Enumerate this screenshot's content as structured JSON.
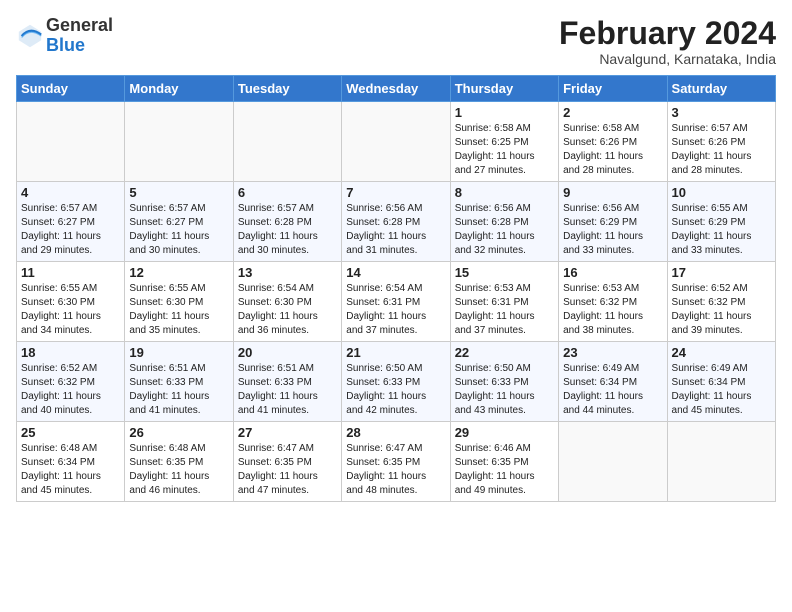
{
  "logo": {
    "general": "General",
    "blue": "Blue"
  },
  "title": "February 2024",
  "location": "Navalgund, Karnataka, India",
  "weekdays": [
    "Sunday",
    "Monday",
    "Tuesday",
    "Wednesday",
    "Thursday",
    "Friday",
    "Saturday"
  ],
  "weeks": [
    [
      {
        "day": "",
        "info": ""
      },
      {
        "day": "",
        "info": ""
      },
      {
        "day": "",
        "info": ""
      },
      {
        "day": "",
        "info": ""
      },
      {
        "day": "1",
        "info": "Sunrise: 6:58 AM\nSunset: 6:25 PM\nDaylight: 11 hours\nand 27 minutes."
      },
      {
        "day": "2",
        "info": "Sunrise: 6:58 AM\nSunset: 6:26 PM\nDaylight: 11 hours\nand 28 minutes."
      },
      {
        "day": "3",
        "info": "Sunrise: 6:57 AM\nSunset: 6:26 PM\nDaylight: 11 hours\nand 28 minutes."
      }
    ],
    [
      {
        "day": "4",
        "info": "Sunrise: 6:57 AM\nSunset: 6:27 PM\nDaylight: 11 hours\nand 29 minutes."
      },
      {
        "day": "5",
        "info": "Sunrise: 6:57 AM\nSunset: 6:27 PM\nDaylight: 11 hours\nand 30 minutes."
      },
      {
        "day": "6",
        "info": "Sunrise: 6:57 AM\nSunset: 6:28 PM\nDaylight: 11 hours\nand 30 minutes."
      },
      {
        "day": "7",
        "info": "Sunrise: 6:56 AM\nSunset: 6:28 PM\nDaylight: 11 hours\nand 31 minutes."
      },
      {
        "day": "8",
        "info": "Sunrise: 6:56 AM\nSunset: 6:28 PM\nDaylight: 11 hours\nand 32 minutes."
      },
      {
        "day": "9",
        "info": "Sunrise: 6:56 AM\nSunset: 6:29 PM\nDaylight: 11 hours\nand 33 minutes."
      },
      {
        "day": "10",
        "info": "Sunrise: 6:55 AM\nSunset: 6:29 PM\nDaylight: 11 hours\nand 33 minutes."
      }
    ],
    [
      {
        "day": "11",
        "info": "Sunrise: 6:55 AM\nSunset: 6:30 PM\nDaylight: 11 hours\nand 34 minutes."
      },
      {
        "day": "12",
        "info": "Sunrise: 6:55 AM\nSunset: 6:30 PM\nDaylight: 11 hours\nand 35 minutes."
      },
      {
        "day": "13",
        "info": "Sunrise: 6:54 AM\nSunset: 6:30 PM\nDaylight: 11 hours\nand 36 minutes."
      },
      {
        "day": "14",
        "info": "Sunrise: 6:54 AM\nSunset: 6:31 PM\nDaylight: 11 hours\nand 37 minutes."
      },
      {
        "day": "15",
        "info": "Sunrise: 6:53 AM\nSunset: 6:31 PM\nDaylight: 11 hours\nand 37 minutes."
      },
      {
        "day": "16",
        "info": "Sunrise: 6:53 AM\nSunset: 6:32 PM\nDaylight: 11 hours\nand 38 minutes."
      },
      {
        "day": "17",
        "info": "Sunrise: 6:52 AM\nSunset: 6:32 PM\nDaylight: 11 hours\nand 39 minutes."
      }
    ],
    [
      {
        "day": "18",
        "info": "Sunrise: 6:52 AM\nSunset: 6:32 PM\nDaylight: 11 hours\nand 40 minutes."
      },
      {
        "day": "19",
        "info": "Sunrise: 6:51 AM\nSunset: 6:33 PM\nDaylight: 11 hours\nand 41 minutes."
      },
      {
        "day": "20",
        "info": "Sunrise: 6:51 AM\nSunset: 6:33 PM\nDaylight: 11 hours\nand 41 minutes."
      },
      {
        "day": "21",
        "info": "Sunrise: 6:50 AM\nSunset: 6:33 PM\nDaylight: 11 hours\nand 42 minutes."
      },
      {
        "day": "22",
        "info": "Sunrise: 6:50 AM\nSunset: 6:33 PM\nDaylight: 11 hours\nand 43 minutes."
      },
      {
        "day": "23",
        "info": "Sunrise: 6:49 AM\nSunset: 6:34 PM\nDaylight: 11 hours\nand 44 minutes."
      },
      {
        "day": "24",
        "info": "Sunrise: 6:49 AM\nSunset: 6:34 PM\nDaylight: 11 hours\nand 45 minutes."
      }
    ],
    [
      {
        "day": "25",
        "info": "Sunrise: 6:48 AM\nSunset: 6:34 PM\nDaylight: 11 hours\nand 45 minutes."
      },
      {
        "day": "26",
        "info": "Sunrise: 6:48 AM\nSunset: 6:35 PM\nDaylight: 11 hours\nand 46 minutes."
      },
      {
        "day": "27",
        "info": "Sunrise: 6:47 AM\nSunset: 6:35 PM\nDaylight: 11 hours\nand 47 minutes."
      },
      {
        "day": "28",
        "info": "Sunrise: 6:47 AM\nSunset: 6:35 PM\nDaylight: 11 hours\nand 48 minutes."
      },
      {
        "day": "29",
        "info": "Sunrise: 6:46 AM\nSunset: 6:35 PM\nDaylight: 11 hours\nand 49 minutes."
      },
      {
        "day": "",
        "info": ""
      },
      {
        "day": "",
        "info": ""
      }
    ]
  ]
}
